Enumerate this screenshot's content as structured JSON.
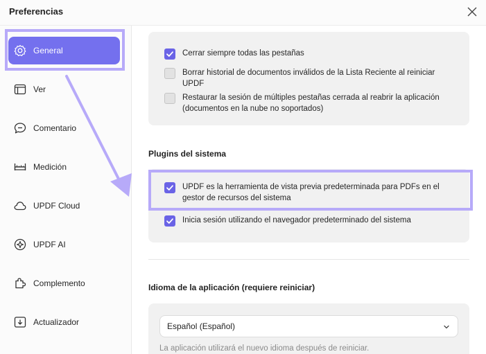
{
  "window": {
    "title": "Preferencias"
  },
  "sidebar": {
    "items": [
      {
        "label": "General",
        "icon": "gear-icon",
        "active": true
      },
      {
        "label": "Ver",
        "icon": "window-icon"
      },
      {
        "label": "Comentario",
        "icon": "comment-icon"
      },
      {
        "label": "Medición",
        "icon": "ruler-icon"
      },
      {
        "label": "UPDF Cloud",
        "icon": "cloud-icon"
      },
      {
        "label": "UPDF AI",
        "icon": "ai-icon"
      },
      {
        "label": "Complemento",
        "icon": "puzzle-icon"
      },
      {
        "label": "Actualizador",
        "icon": "update-icon"
      }
    ]
  },
  "tabs_section": {
    "options": [
      {
        "label": "Cerrar siempre todas las pestañas",
        "checked": true
      },
      {
        "label": "Borrar historial de documentos inválidos de la Lista Reciente al reiniciar UPDF",
        "checked": false
      },
      {
        "label": "Restaurar la sesión de múltiples pestañas cerrada al reabrir la aplicación (documentos en la nube no soportados)",
        "checked": false
      }
    ]
  },
  "plugins": {
    "title": "Plugins del sistema",
    "options": [
      {
        "label": "UPDF es la herramienta de vista previa predeterminada para PDFs en el gestor de recursos del sistema",
        "checked": true
      },
      {
        "label": "Inicia sesión utilizando el navegador predeterminado del sistema",
        "checked": true
      }
    ]
  },
  "language": {
    "title": "Idioma de la aplicación (requiere reiniciar)",
    "selected": "Español (Español)",
    "hint": "La aplicación utilizará el nuevo idioma después de reiniciar."
  },
  "colors": {
    "accent": "#7470ee",
    "checkbox": "#6a63e6",
    "highlight": "#b7aaf9"
  }
}
